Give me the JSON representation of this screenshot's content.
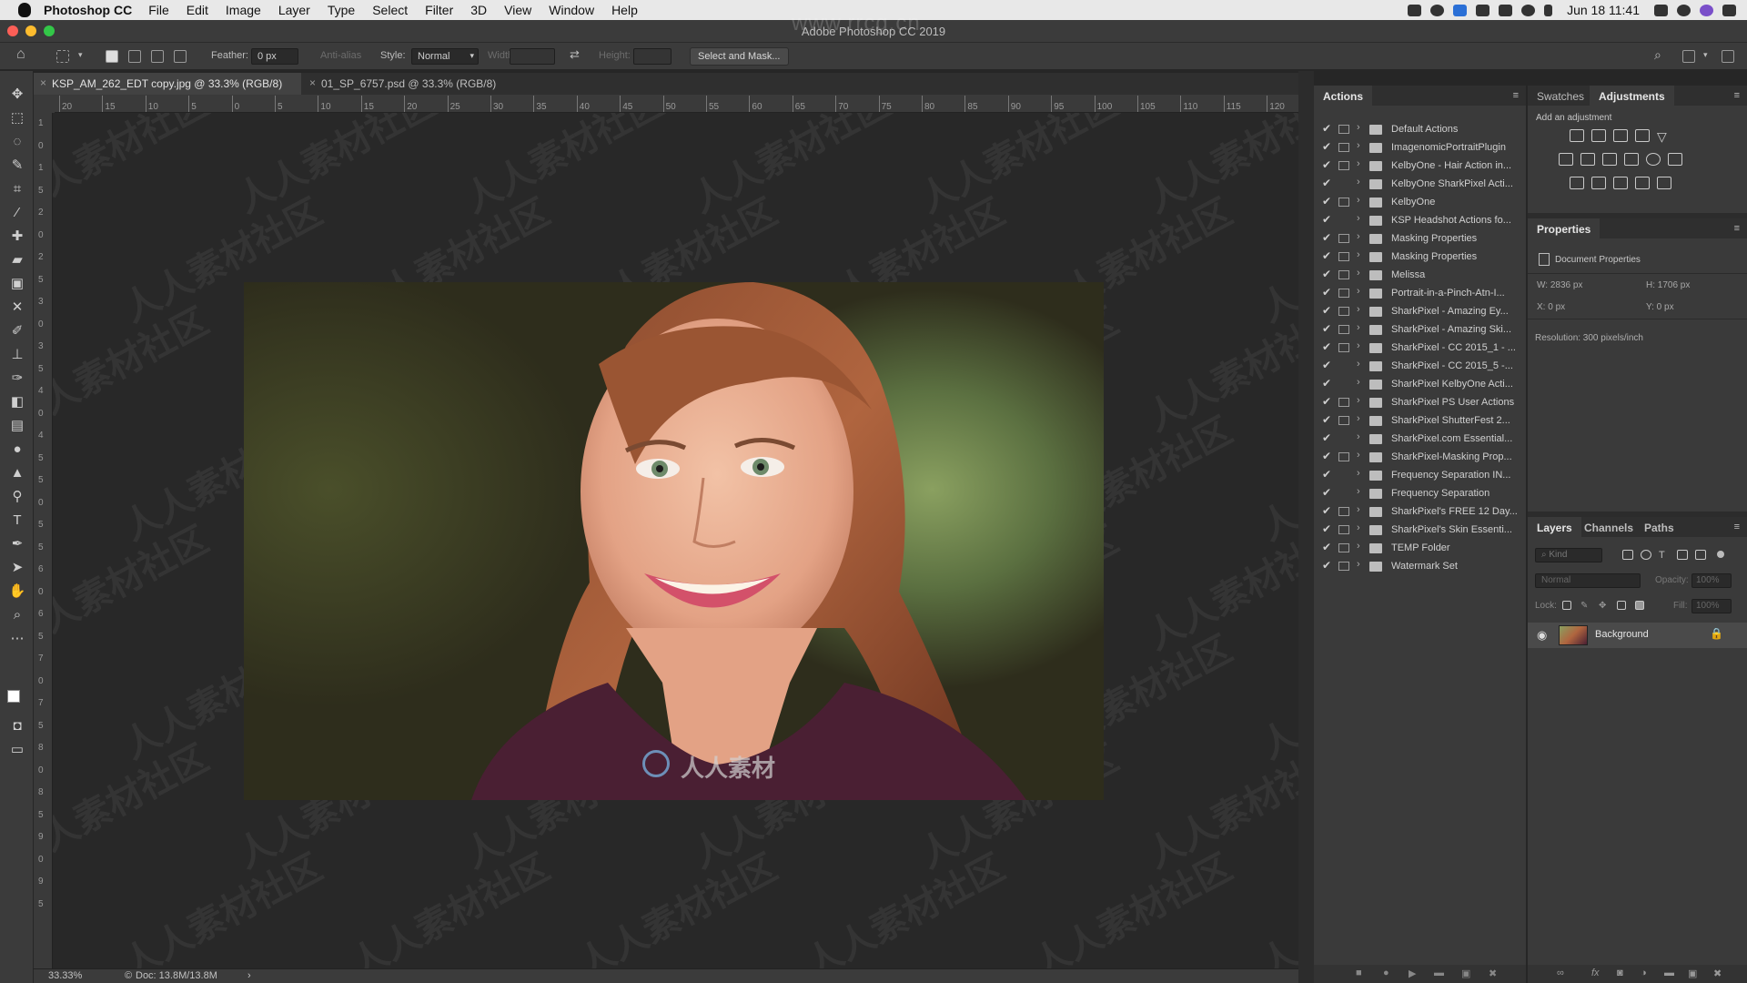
{
  "menubar": {
    "app": "Photoshop CC",
    "items": [
      "File",
      "Edit",
      "Image",
      "Layer",
      "Type",
      "Select",
      "Filter",
      "3D",
      "View",
      "Window",
      "Help"
    ],
    "clock": "Jun 18  11:41"
  },
  "window": {
    "title": "Adobe Photoshop CC 2019"
  },
  "options": {
    "feather_label": "Feather:",
    "feather_value": "0 px",
    "antialias_label": "Anti-alias",
    "style_label": "Style:",
    "style_value": "Normal",
    "width_label": "Width:",
    "height_label": "Height:",
    "select_mask": "Select and Mask..."
  },
  "tabs": [
    {
      "label": "KSP_AM_262_EDT copy.jpg @ 33.3% (RGB/8)"
    },
    {
      "label": "01_SP_6757.psd @ 33.3% (RGB/8)"
    }
  ],
  "ruler_h": [
    "20",
    "15",
    "10",
    "5",
    "0",
    "5",
    "10",
    "15",
    "20",
    "25",
    "30",
    "35",
    "40",
    "45",
    "50",
    "55",
    "60",
    "65",
    "70",
    "75",
    "80",
    "85",
    "90",
    "95",
    "100",
    "105",
    "110",
    "115",
    "120"
  ],
  "ruler_v": [
    "1",
    "0",
    "1",
    "5",
    "2",
    "0",
    "2",
    "5",
    "3",
    "0",
    "3",
    "5",
    "4",
    "0",
    "4",
    "5",
    "5",
    "0",
    "5",
    "5",
    "6",
    "0",
    "6",
    "5",
    "7",
    "0",
    "7",
    "5",
    "8",
    "0",
    "8",
    "5",
    "9",
    "0",
    "9",
    "5"
  ],
  "status": {
    "zoom": "33.33%",
    "doc": "Doc: 13.8M/13.8M"
  },
  "actions_panel": {
    "title": "Actions",
    "items": [
      "Default Actions",
      "ImagenomicPortraitPlugin",
      "KelbyOne - Hair Action in...",
      "KelbyOne SharkPixel Acti...",
      "KelbyOne",
      "KSP Headshot Actions fo...",
      "Masking Properties",
      "Masking Properties",
      "Melissa",
      "Portrait-in-a-Pinch-Atn-I...",
      "SharkPixel - Amazing Ey...",
      "SharkPixel - Amazing Ski...",
      "SharkPixel - CC 2015_1 - ...",
      "SharkPixel - CC 2015_5 -...",
      "SharkPixel KelbyOne Acti...",
      "SharkPixel PS User Actions",
      "SharkPixel ShutterFest 2...",
      "SharkPixel.com Essential...",
      "SharkPixel-Masking Prop...",
      "Frequency Separation IN...",
      "Frequency Separation",
      "SharkPixel's FREE 12 Day...",
      "SharkPixel's Skin Essenti...",
      "TEMP Folder",
      "Watermark Set"
    ]
  },
  "adjust_panel": {
    "tab_swatches": "Swatches",
    "tab_adjustments": "Adjustments",
    "hint": "Add an adjustment"
  },
  "properties_panel": {
    "title": "Properties",
    "doc_label": "Document Properties",
    "w": "W: 2836 px",
    "h": "H: 1706 px",
    "x": "X: 0 px",
    "y": "Y: 0 px",
    "resolution": "Resolution: 300 pixels/inch"
  },
  "layers_panel": {
    "tabs": [
      "Layers",
      "Channels",
      "Paths"
    ],
    "kind": "Kind",
    "blend": "Normal",
    "opacity_label": "Opacity:",
    "opacity": "100%",
    "lock_label": "Lock:",
    "fill_label": "Fill:",
    "fill": "100%",
    "layer_name": "Background"
  },
  "watermark_text": "www.rrcg.cn",
  "watermark_bottom": "人人素材",
  "colors": {
    "accent_active_tab": "#424242",
    "panel_bg": "#3a3a3a"
  }
}
